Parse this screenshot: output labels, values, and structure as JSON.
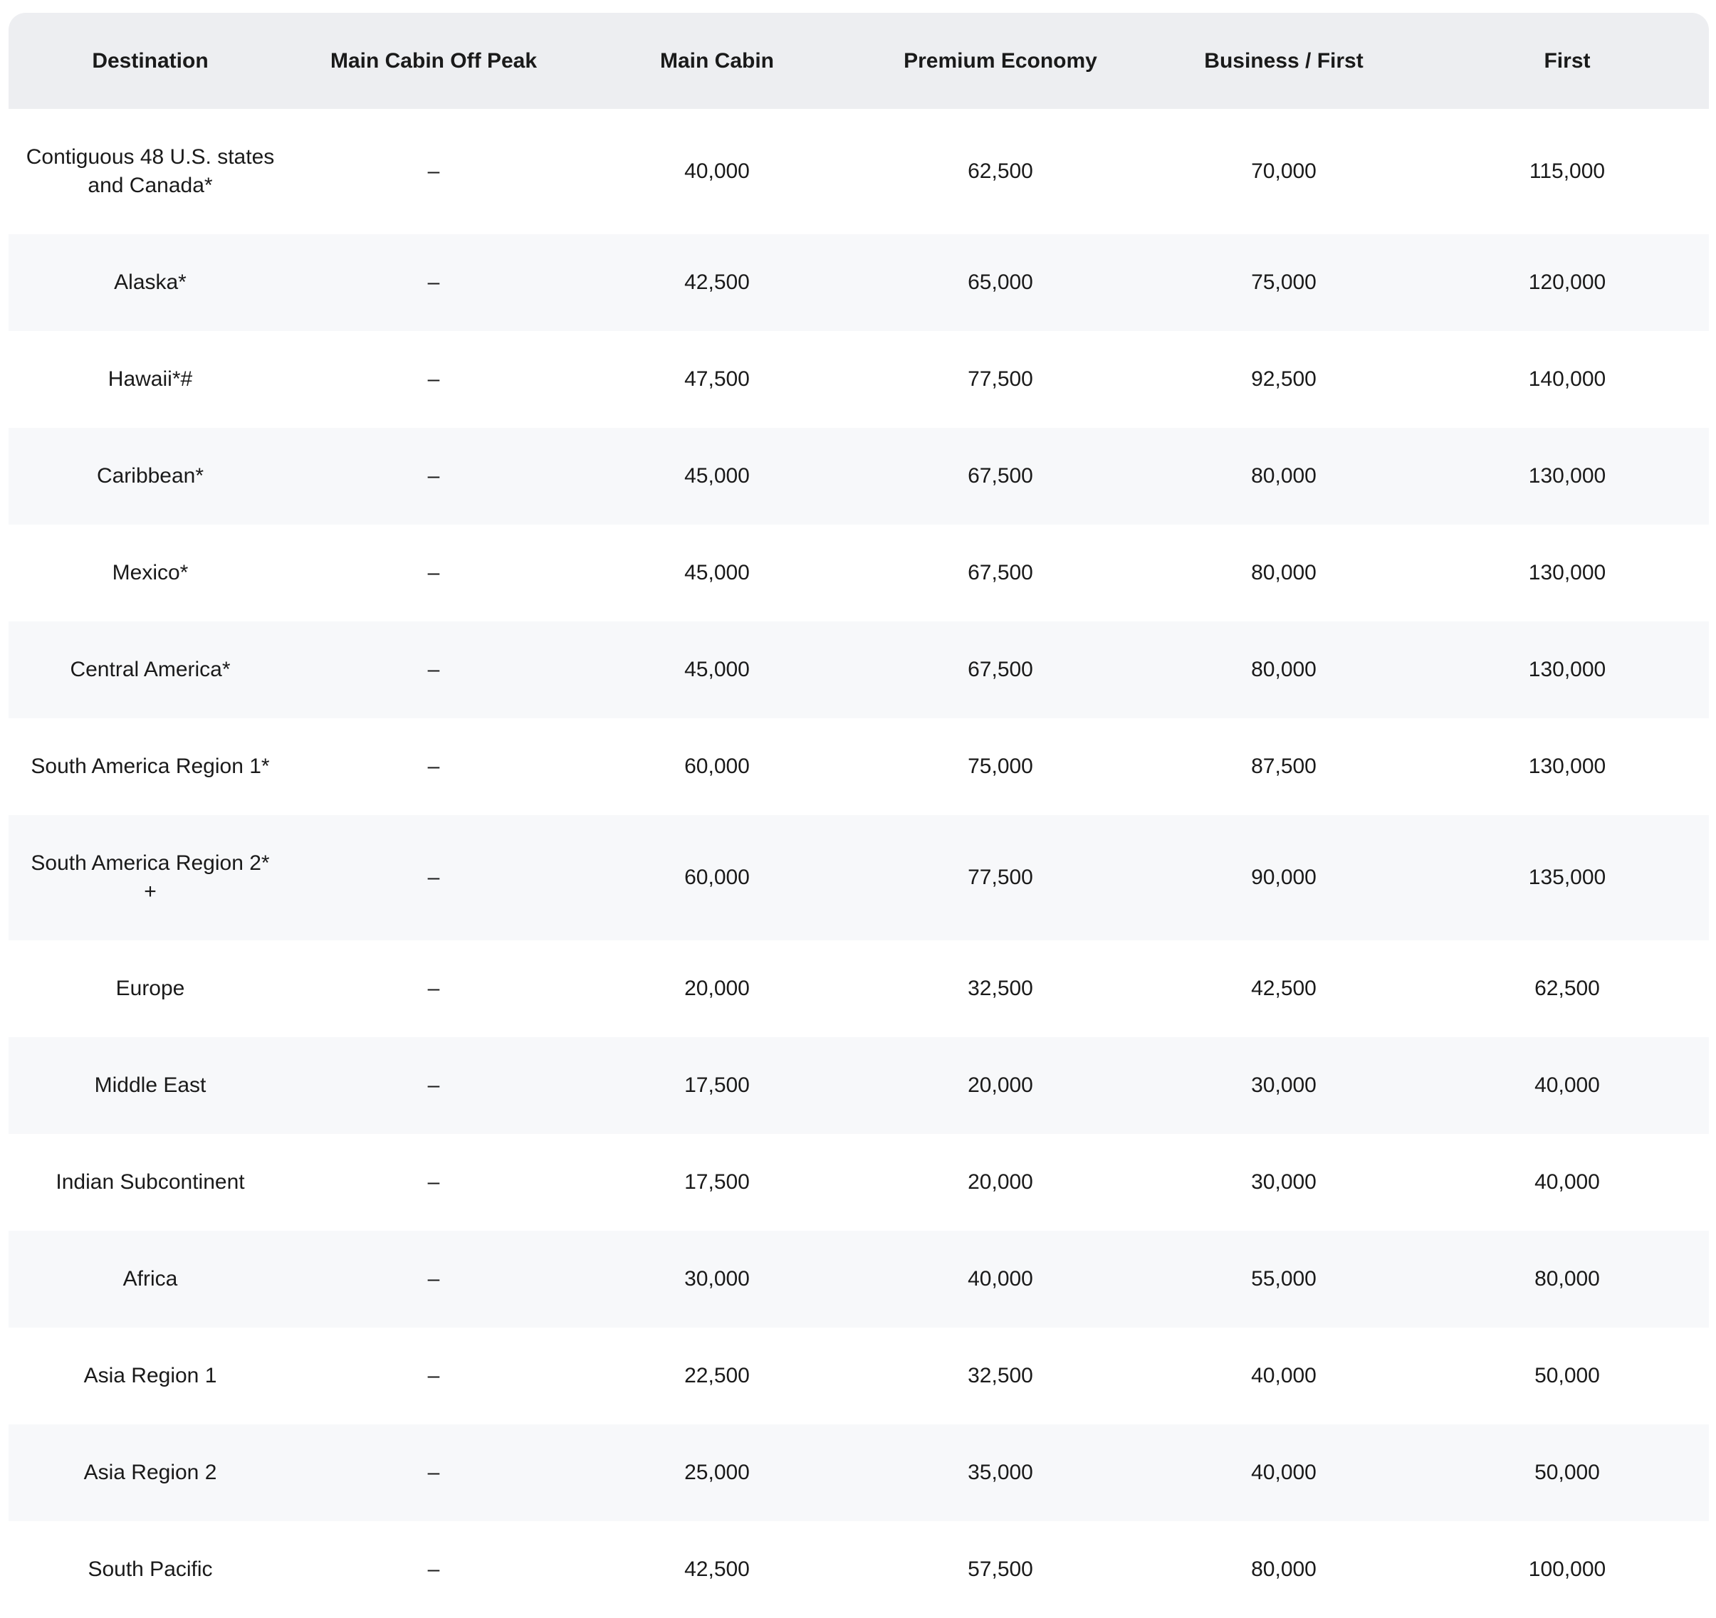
{
  "table": {
    "headers": [
      "Destination",
      "Main Cabin Off Peak",
      "Main Cabin",
      "Premium Economy",
      "Business / First",
      "First"
    ],
    "rows": [
      {
        "destination": "Contiguous 48 U.S. states and Canada*",
        "off_peak": "–",
        "main": "40,000",
        "premium": "62,500",
        "business": "70,000",
        "first": "115,000"
      },
      {
        "destination": "Alaska*",
        "off_peak": "–",
        "main": "42,500",
        "premium": "65,000",
        "business": "75,000",
        "first": "120,000"
      },
      {
        "destination": "Hawaii*#",
        "off_peak": "–",
        "main": "47,500",
        "premium": "77,500",
        "business": "92,500",
        "first": "140,000"
      },
      {
        "destination": "Caribbean*",
        "off_peak": "–",
        "main": "45,000",
        "premium": "67,500",
        "business": "80,000",
        "first": "130,000"
      },
      {
        "destination": "Mexico*",
        "off_peak": "–",
        "main": "45,000",
        "premium": "67,500",
        "business": "80,000",
        "first": "130,000"
      },
      {
        "destination": "Central America*",
        "off_peak": "–",
        "main": "45,000",
        "premium": "67,500",
        "business": "80,000",
        "first": "130,000"
      },
      {
        "destination": "South America Region 1*",
        "off_peak": "–",
        "main": "60,000",
        "premium": "75,000",
        "business": "87,500",
        "first": "130,000"
      },
      {
        "destination": "South America Region 2* +",
        "off_peak": "–",
        "main": "60,000",
        "premium": "77,500",
        "business": "90,000",
        "first": "135,000"
      },
      {
        "destination": "Europe",
        "off_peak": "–",
        "main": "20,000",
        "premium": "32,500",
        "business": "42,500",
        "first": "62,500"
      },
      {
        "destination": "Middle East",
        "off_peak": "–",
        "main": "17,500",
        "premium": "20,000",
        "business": "30,000",
        "first": "40,000"
      },
      {
        "destination": "Indian Subcontinent",
        "off_peak": "–",
        "main": "17,500",
        "premium": "20,000",
        "business": "30,000",
        "first": "40,000"
      },
      {
        "destination": "Africa",
        "off_peak": "–",
        "main": "30,000",
        "premium": "40,000",
        "business": "55,000",
        "first": "80,000"
      },
      {
        "destination": "Asia Region 1",
        "off_peak": "–",
        "main": "22,500",
        "premium": "32,500",
        "business": "40,000",
        "first": "50,000"
      },
      {
        "destination": "Asia Region 2",
        "off_peak": "–",
        "main": "25,000",
        "premium": "35,000",
        "business": "40,000",
        "first": "50,000"
      },
      {
        "destination": "South Pacific",
        "off_peak": "–",
        "main": "42,500",
        "premium": "57,500",
        "business": "80,000",
        "first": "100,000"
      }
    ]
  }
}
